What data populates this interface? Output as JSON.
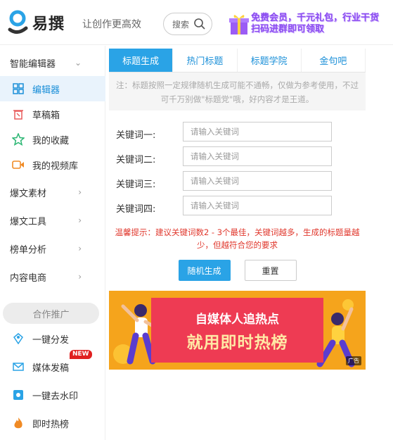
{
  "header": {
    "logo_text": "易撰",
    "slogan": "让创作更高效",
    "search_label": "搜索",
    "promo_line1": "免费会员，千元礼包，行业干货",
    "promo_line2": "扫码进群即可领取"
  },
  "sidebar": {
    "editor_group": "智能编辑器",
    "sub_items": [
      {
        "label": "编辑器"
      },
      {
        "label": "草稿箱"
      },
      {
        "label": "我的收藏"
      },
      {
        "label": "我的视频库"
      }
    ],
    "groups": [
      {
        "label": "爆文素材"
      },
      {
        "label": "爆文工具"
      },
      {
        "label": "榜单分析"
      },
      {
        "label": "内容电商"
      }
    ],
    "coop_label": "合作推广",
    "promo_items": [
      {
        "label": "一键分发"
      },
      {
        "label": "媒体发稿",
        "badge": "NEW"
      },
      {
        "label": "一键去水印"
      },
      {
        "label": "即时热榜"
      }
    ]
  },
  "main": {
    "tabs": [
      {
        "label": "标题生成"
      },
      {
        "label": "热门标题"
      },
      {
        "label": "标题学院"
      },
      {
        "label": "金句吧"
      }
    ],
    "note": "注：标题按照一定规律随机生成可能不通畅，仅做为参考使用，不过可千万别做\"标题党\"哦，好内容才是王道。",
    "fields": [
      {
        "label": "关键词一:",
        "placeholder": "请输入关键词"
      },
      {
        "label": "关键词二:",
        "placeholder": "请输入关键词"
      },
      {
        "label": "关键词三:",
        "placeholder": "请输入关键词"
      },
      {
        "label": "关键词四:",
        "placeholder": "请输入关键词"
      }
    ],
    "tip": "温馨提示：建议关键词数2 - 3个最佳，关键词越多，生成的标题量越少，但越符合您的要求",
    "generate_label": "随机生成",
    "reset_label": "重置"
  },
  "banner": {
    "line1": "自媒体人追热点",
    "line2": "就用即时热榜",
    "ad_label": "广告"
  },
  "colors": {
    "accent": "#2aa3e6",
    "tip_red": "#e0372c",
    "banner_orange": "#f5a41c",
    "banner_red": "#ee3b53"
  }
}
